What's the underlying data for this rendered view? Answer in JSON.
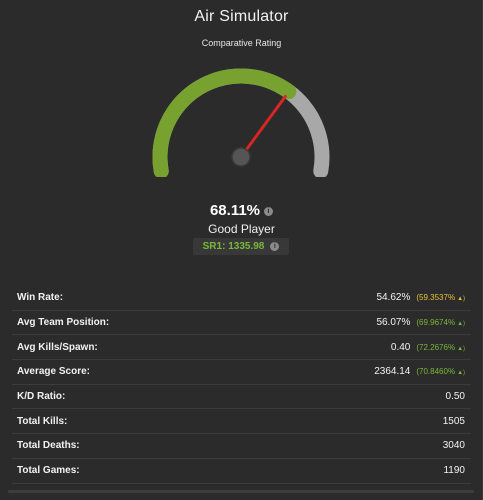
{
  "header": {
    "title": "Air Simulator",
    "subtitle": "Comparative Rating"
  },
  "rating": {
    "percent": "68.11%",
    "gauge_fraction": 0.6811,
    "verdict": "Good Player",
    "sr_label": "SR1: 1335.98",
    "info_icon": "i"
  },
  "colors": {
    "gauge_fill": "#78a22f",
    "gauge_track": "#a8a8a8",
    "needle": "#d62626",
    "percentile_green": "#7ab83a",
    "percentile_yellow": "#e5c23a"
  },
  "stats": [
    {
      "label": "Win Rate:",
      "value": "54.62%",
      "percentile": "(59.3537%",
      "arrow": "▲)",
      "color": "yellow"
    },
    {
      "label": "Avg Team Position:",
      "value": "56.07%",
      "percentile": "(69.9674%",
      "arrow": "▲)",
      "color": "green"
    },
    {
      "label": "Avg Kills/Spawn:",
      "value": "0.40",
      "percentile": "(72.2676%",
      "arrow": "▲)",
      "color": "green"
    },
    {
      "label": "Average Score:",
      "value": "2364.14",
      "percentile": "(70.8460%",
      "arrow": "▲)",
      "color": "green"
    },
    {
      "label": "K/D Ratio:",
      "value": "0.50",
      "percentile": "",
      "arrow": "",
      "color": ""
    },
    {
      "label": "Total Kills:",
      "value": "1505",
      "percentile": "",
      "arrow": "",
      "color": ""
    },
    {
      "label": "Total Deaths:",
      "value": "3040",
      "percentile": "",
      "arrow": "",
      "color": ""
    },
    {
      "label": "Total Games:",
      "value": "1190",
      "percentile": "",
      "arrow": "",
      "color": ""
    }
  ]
}
